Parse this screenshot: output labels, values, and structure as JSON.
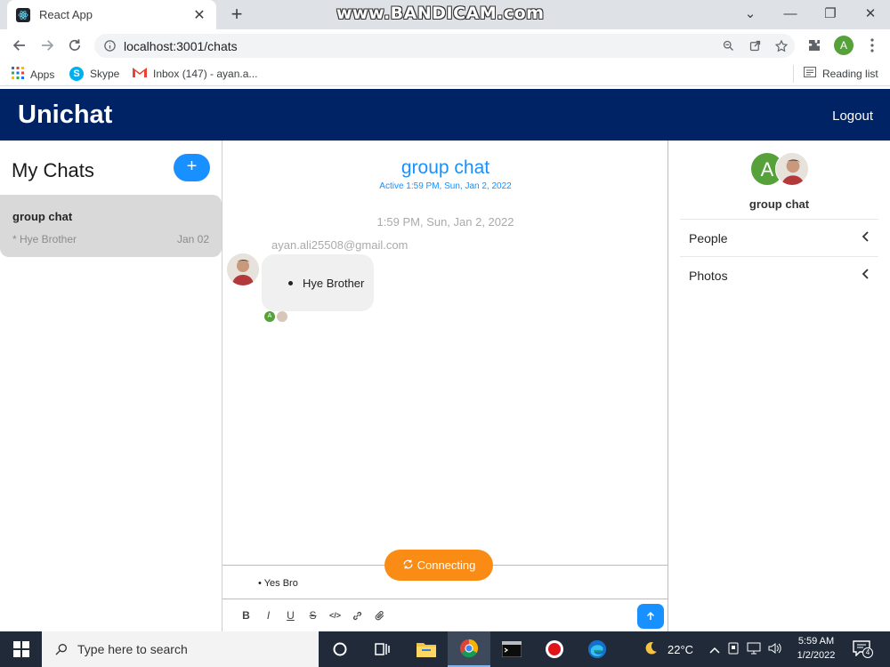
{
  "browser": {
    "tab_title": "React App",
    "url": "localhost:3001/chats",
    "profile_initial": "A",
    "bookmarks": [
      {
        "label": "Apps",
        "icon": "apps-grid-icon"
      },
      {
        "label": "Skype",
        "icon": "skype-icon"
      },
      {
        "label": "Inbox (147) - ayan.a...",
        "icon": "gmail-icon"
      }
    ],
    "reading_list": "Reading list"
  },
  "watermark": "www.BANDICAM.com",
  "app": {
    "brand": "Unichat",
    "logout": "Logout"
  },
  "chat_list": {
    "heading": "My Chats",
    "new_button": "+",
    "chats": [
      {
        "name": "group chat",
        "preview": "* Hye Brother",
        "date": "Jan 02"
      }
    ]
  },
  "chat_feed": {
    "title": "group chat",
    "active": "Active 1:59 PM, Sun, Jan 2, 2022",
    "timestamp": "1:59 PM, Sun, Jan 2, 2022",
    "messages": [
      {
        "sender": "ayan.ali25508@gmail.com",
        "text": "Hye Brother"
      }
    ],
    "read_receipt_initial": "A",
    "connecting": "Connecting",
    "draft": "• Yes Bro",
    "format_buttons": [
      "B",
      "I",
      "U",
      "S",
      "</>",
      "link",
      "attach"
    ]
  },
  "chat_settings": {
    "avatar_initial": "A",
    "title": "group chat",
    "sections": [
      "People",
      "Photos"
    ]
  },
  "taskbar": {
    "search_placeholder": "Type here to search",
    "weather": "22°C",
    "time": "5:59 AM",
    "date": "1/2/2022",
    "notification_count": "4"
  },
  "colors": {
    "header_bg": "#002366",
    "accent": "#1890ff",
    "connecting": "#fa8c16",
    "selected_chat": "#d9d9d9"
  }
}
